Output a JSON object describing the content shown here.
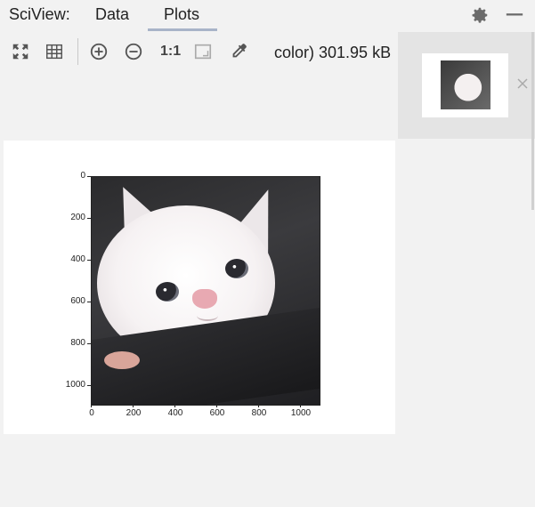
{
  "header": {
    "title": "SciView:",
    "tabs": [
      {
        "label": "Data",
        "active": false
      },
      {
        "label": "Plots",
        "active": true
      }
    ],
    "icons": [
      "gear-icon",
      "minimize-icon"
    ]
  },
  "toolbar": {
    "icons": [
      "fit-to-window-icon",
      "grid-icon",
      "zoom-in-icon",
      "zoom-out-icon",
      "actual-size-icon",
      "fit-zoom-icon",
      "color-picker-icon"
    ],
    "actual_size_label": "1:1",
    "file_info": "color) 301.95 kB"
  },
  "plot": {
    "y_ticks": [
      "0",
      "200",
      "400",
      "600",
      "800",
      "1000"
    ],
    "x_ticks": [
      "0",
      "200",
      "400",
      "600",
      "800",
      "1000"
    ]
  },
  "colors": {
    "background": "#f2f2f2",
    "tab_underline": "#a8b4c8",
    "thumbnail_panel": "#e4e4e4"
  }
}
